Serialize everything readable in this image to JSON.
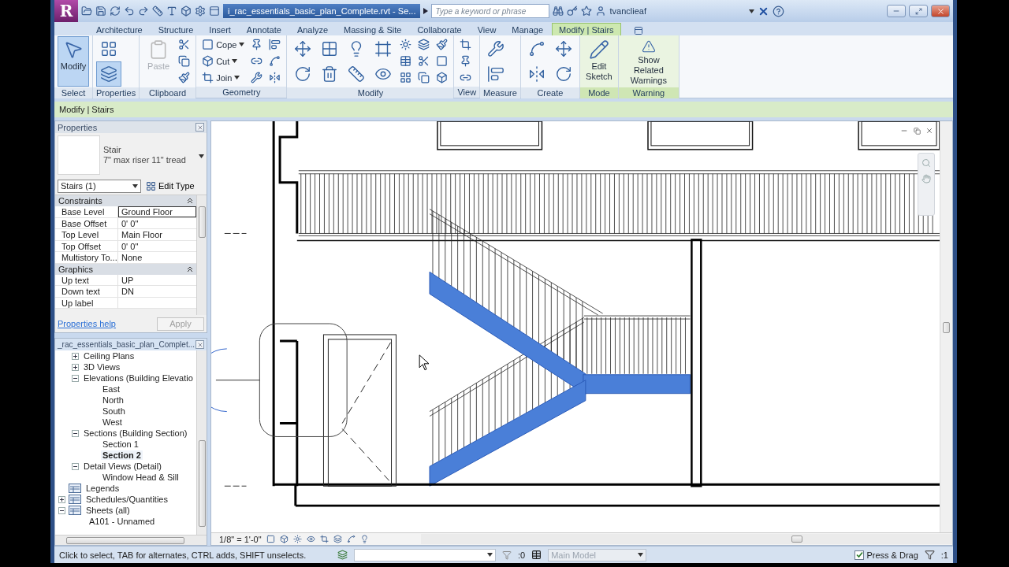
{
  "title_bar": {
    "app_logo": "R",
    "document_title": "i_rac_essentials_basic_plan_Complete.rvt - Se...",
    "search": {
      "placeholder": "Type a keyword or phrase"
    },
    "user": "tvanclieaf"
  },
  "ribbon": {
    "tabs": [
      {
        "label": "Architecture",
        "selected": false
      },
      {
        "label": "Structure",
        "selected": false
      },
      {
        "label": "Insert",
        "selected": false
      },
      {
        "label": "Annotate",
        "selected": false
      },
      {
        "label": "Analyze",
        "selected": false
      },
      {
        "label": "Massing & Site",
        "selected": false
      },
      {
        "label": "Collaborate",
        "selected": false
      },
      {
        "label": "View",
        "selected": false
      },
      {
        "label": "Manage",
        "selected": false
      },
      {
        "label": "Modify | Stairs",
        "selected": true
      }
    ],
    "panels": [
      {
        "label": "Select",
        "contextual": false,
        "tools": [
          {
            "kind": "large",
            "label": "Modify",
            "selected": true
          }
        ]
      },
      {
        "label": "Properties",
        "contextual": false,
        "tools": [
          {
            "kind": "medium",
            "selected": false
          },
          {
            "kind": "medium",
            "selected": true
          }
        ]
      },
      {
        "label": "Clipboard",
        "contextual": false,
        "tools": [
          {
            "kind": "large",
            "label": "Paste",
            "disabled": true
          },
          {
            "kind": "icon"
          },
          {
            "kind": "icon"
          },
          {
            "kind": "icon"
          }
        ]
      },
      {
        "label": "Geometry",
        "contextual": false,
        "tools": [
          {
            "kind": "small",
            "label": "Cope"
          },
          {
            "kind": "small",
            "label": "Cut"
          },
          {
            "kind": "small",
            "label": "Join"
          },
          {
            "kind": "icon"
          },
          {
            "kind": "icon"
          },
          {
            "kind": "icon"
          },
          {
            "kind": "icon"
          },
          {
            "kind": "icon"
          },
          {
            "kind": "icon"
          }
        ]
      },
      {
        "label": "Modify",
        "contextual": false,
        "tools": [
          {
            "kind": "medium"
          },
          {
            "kind": "medium"
          },
          {
            "kind": "medium"
          },
          {
            "kind": "medium"
          },
          {
            "kind": "medium"
          },
          {
            "kind": "medium"
          },
          {
            "kind": "medium"
          },
          {
            "kind": "medium"
          },
          {
            "kind": "icon"
          },
          {
            "kind": "icon"
          },
          {
            "kind": "icon"
          },
          {
            "kind": "icon"
          },
          {
            "kind": "icon"
          },
          {
            "kind": "icon"
          },
          {
            "kind": "icon"
          },
          {
            "kind": "icon"
          },
          {
            "kind": "icon"
          }
        ]
      },
      {
        "label": "View",
        "contextual": false,
        "tools": [
          {
            "kind": "icon"
          },
          {
            "kind": "icon"
          },
          {
            "kind": "icon"
          }
        ]
      },
      {
        "label": "Measure",
        "contextual": false,
        "tools": [
          {
            "kind": "medium"
          },
          {
            "kind": "medium"
          }
        ]
      },
      {
        "label": "Create",
        "contextual": false,
        "tools": [
          {
            "kind": "medium"
          },
          {
            "kind": "medium"
          },
          {
            "kind": "medium"
          },
          {
            "kind": "medium"
          }
        ]
      },
      {
        "label": "Mode",
        "contextual": true,
        "tools": [
          {
            "kind": "large",
            "label": "Edit Sketch"
          }
        ]
      },
      {
        "label": "Warning",
        "contextual": true,
        "tools": [
          {
            "kind": "large",
            "label": "Show Related Warnings"
          }
        ]
      }
    ]
  },
  "context_bar": "Modify | Stairs",
  "properties": {
    "title": "Properties",
    "type_family": "Stair",
    "type_name": "7\" max riser 11\" tread",
    "instance_selector": "Stairs (1)",
    "edit_type": "Edit Type",
    "groups": [
      {
        "name": "Constraints",
        "expanded": true,
        "rows": [
          {
            "label": "Base Level",
            "value": "Ground Floor",
            "selected": true
          },
          {
            "label": "Base Offset",
            "value": "0'  0\"",
            "selected": false
          },
          {
            "label": "Top Level",
            "value": "Main Floor",
            "selected": false
          },
          {
            "label": "Top Offset",
            "value": "0'  0\"",
            "selected": false
          },
          {
            "label": "Multistory To...",
            "value": "None",
            "selected": false
          }
        ]
      },
      {
        "name": "Graphics",
        "expanded": true,
        "rows": [
          {
            "label": "Up text",
            "value": "UP",
            "selected": false
          },
          {
            "label": "Down text",
            "value": "DN",
            "selected": false
          },
          {
            "label": "Up label",
            "selected": false
          }
        ]
      }
    ],
    "help_link": "Properties help",
    "apply": {
      "label": "Apply",
      "disabled": true
    }
  },
  "project_browser": {
    "title": "_rac_essentials_basic_plan_Complet...",
    "tree": [
      {
        "kind": "group",
        "children": [
          {
            "kind": "folder",
            "label": "Ceiling Plans",
            "expanded": false,
            "selected": false
          },
          {
            "kind": "folder",
            "label": "3D Views",
            "expanded": false,
            "selected": false
          },
          {
            "kind": "folder",
            "label": "Elevations (Building Elevatio",
            "expanded": true,
            "selected": false,
            "children": [
              {
                "kind": "view",
                "label": "East",
                "selected": false
              },
              {
                "kind": "view",
                "label": "North",
                "selected": false
              },
              {
                "kind": "view",
                "label": "South",
                "selected": false
              },
              {
                "kind": "view",
                "label": "West",
                "selected": false
              }
            ]
          },
          {
            "kind": "folder",
            "label": "Sections (Building Section)",
            "expanded": true,
            "selected": false,
            "children": [
              {
                "kind": "view",
                "label": "Section 1",
                "selected": false
              },
              {
                "kind": "view",
                "label": "Section 2",
                "selected": true
              }
            ]
          },
          {
            "kind": "folder",
            "label": "Detail Views (Detail)",
            "expanded": true,
            "selected": false,
            "children": [
              {
                "kind": "view",
                "label": "Window Head & Sill",
                "selected": false
              }
            ]
          }
        ]
      },
      {
        "kind": "category",
        "label": "Legends",
        "selected": false
      },
      {
        "kind": "category",
        "label": "Schedules/Quantities",
        "expanded": false,
        "selected": false
      },
      {
        "kind": "category",
        "label": "Sheets (all)",
        "expanded": true,
        "selected": false,
        "children": [
          {
            "kind": "view",
            "label": "A101 - Unnamed",
            "selected": false
          }
        ]
      }
    ]
  },
  "view_control_bar": {
    "scale": "1/8\" = 1'-0\""
  },
  "status_bar": {
    "hint": "Click to select, TAB for alternates, CTRL adds, SHIFT unselects.",
    "selection_count": ":0",
    "workset": {
      "value": "Main Model",
      "disabled": true
    },
    "press_drag": {
      "label": "Press & Drag",
      "checked": true
    },
    "filter_count": ":1"
  }
}
